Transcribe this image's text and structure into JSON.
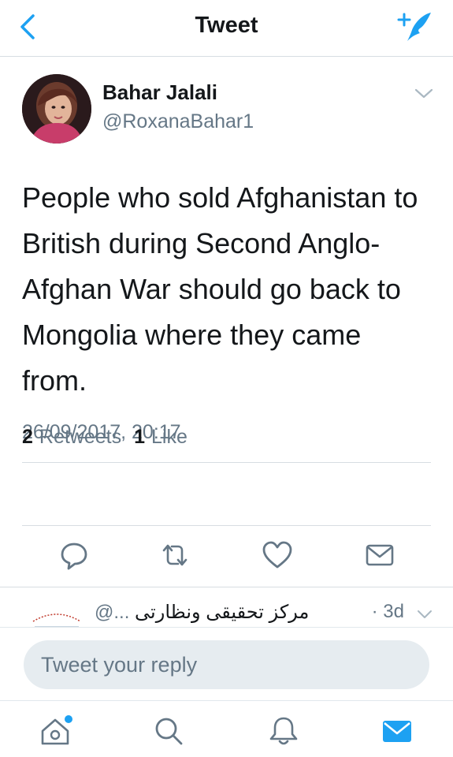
{
  "header": {
    "title": "Tweet"
  },
  "tweet": {
    "author_name": "Bahar Jalali",
    "author_handle": "@RoxanaBahar1",
    "text": "People who sold Afghanistan to British during Second Anglo-Afghan War should go back to Mongolia where they came from.",
    "timestamp": "26/09/2017, 20:17",
    "retweets_count": "2",
    "retweets_label": "Retweets",
    "likes_count": "1",
    "likes_label": "Like"
  },
  "reply_preview": {
    "name": "مرکز تحقیقی ونظارتی",
    "handle": "@...",
    "time": "· 3d"
  },
  "reply_box": {
    "placeholder": "Tweet your reply"
  },
  "colors": {
    "accent": "#1da1f2",
    "muted": "#657786",
    "text": "#14171a",
    "divider": "#d7dde2"
  },
  "icons": [
    "back-chevron-icon",
    "compose-icon",
    "reply-icon",
    "retweet-icon",
    "like-icon",
    "share-icon",
    "home-icon",
    "search-icon",
    "notifications-icon",
    "messages-icon"
  ]
}
